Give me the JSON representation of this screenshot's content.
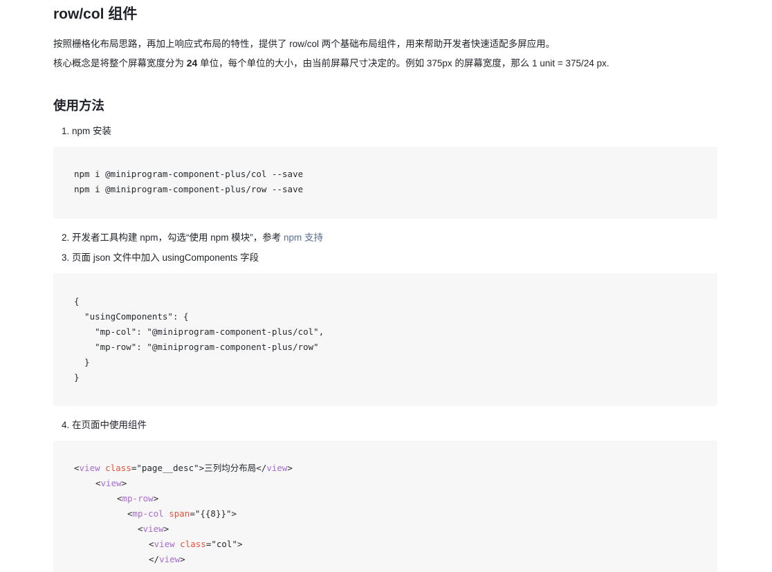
{
  "title": "row/col 组件",
  "intro": {
    "p1": "按照栅格化布局思路，再加上响应式布局的特性，提供了 row/col 两个基础布局组件，用来帮助开发者快速适配多屏应用。",
    "p2_before": "核心概念是将整个屏幕宽度分为 ",
    "p2_bold": "24",
    "p2_after": " 单位，每个单位的大小，由当前屏幕尺寸决定的。例如 375px 的屏幕宽度，那么 1 unit = 375/24 px."
  },
  "usage_heading": "使用方法",
  "steps": {
    "s1": "1. npm 安装",
    "s2_text": "2. 开发者工具构建 npm，勾选“使用 npm 模块”，参考 ",
    "s2_link": "npm 支持",
    "s3": "3. 页面 json 文件中加入 usingComponents 字段",
    "s4": "4. 在页面中使用组件"
  },
  "code_npm": [
    "npm i @miniprogram-component-plus/col --save",
    "npm i @miniprogram-component-plus/row --save"
  ],
  "code_json": [
    "{",
    "  \"usingComponents\": {",
    "    \"mp-col\": \"@miniprogram-component-plus/col\",",
    "    \"mp-row\": \"@miniprogram-component-plus/row\"",
    "  }",
    "}"
  ],
  "code_wxml": {
    "l1": {
      "open": "<",
      "tag": "view",
      "attr": "class",
      "eq": "=",
      "val": "\"page__desc\"",
      "close": ">",
      "text": "三列均分布局",
      "end_open": "</",
      "end_tag": "view",
      "end_close": ">"
    },
    "l2": {
      "open": "<",
      "tag": "view",
      "close": ">"
    },
    "l3": {
      "open": "<",
      "tag": "mp-row",
      "close": ">"
    },
    "l4": {
      "open": "<",
      "tag": "mp-col",
      "attr": "span",
      "eq": "=",
      "val": "\"{{8}}\"",
      "close": ">"
    },
    "l5": {
      "open": "<",
      "tag": "view",
      "close": ">"
    },
    "l6": {
      "open": "<",
      "tag": "view",
      "attr": "class",
      "eq": "=",
      "val": "\"col\"",
      "close": ">"
    },
    "l7": {
      "open": "</",
      "tag": "view",
      "close": ">"
    }
  },
  "colors": {
    "code_bg": "#f7f7f7",
    "link": "#576b95",
    "tag": "#a86bd1",
    "attr": "#e0533b"
  }
}
